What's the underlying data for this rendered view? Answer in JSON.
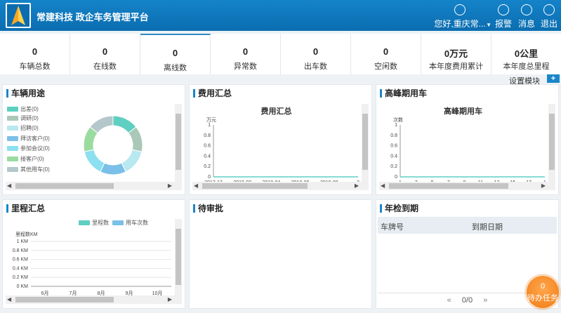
{
  "app": {
    "title": "常建科技 政企车务管理平台"
  },
  "header": {
    "user_label": "您好,重庆常...",
    "alarm_label": "报警",
    "message_label": "消息",
    "logout_label": "退出"
  },
  "stats": [
    {
      "value": "0",
      "label": "车辆总数"
    },
    {
      "value": "0",
      "label": "在线数"
    },
    {
      "value": "0",
      "label": "离线数"
    },
    {
      "value": "0",
      "label": "异常数"
    },
    {
      "value": "0",
      "label": "出车数"
    },
    {
      "value": "0",
      "label": "空闲数"
    },
    {
      "value": "0万元",
      "label": "本年度费用累计"
    },
    {
      "value": "0公里",
      "label": "本年度总里程"
    }
  ],
  "settings": {
    "label": "设置模块",
    "add_label": "+"
  },
  "panels": {
    "vehicle_use": {
      "title": "车辆用途",
      "legend": [
        {
          "label": "出差(0)",
          "color": "#5ecfc0"
        },
        {
          "label": "调研(0)",
          "color": "#aac8b8"
        },
        {
          "label": "招聘(0)",
          "color": "#b8e8f0"
        },
        {
          "label": "拜访客户(0)",
          "color": "#7ac0e8"
        },
        {
          "label": "参加会议(0)",
          "color": "#8ce0f0"
        },
        {
          "label": "接客户(0)",
          "color": "#9adca0"
        },
        {
          "label": "其他用车(0)",
          "color": "#b4c8cc"
        }
      ]
    },
    "cost": {
      "title": "费用汇总",
      "chart_title": "费用汇总",
      "unit": "万元"
    },
    "peak": {
      "title": "高峰期用车",
      "chart_title": "高峰期用车",
      "unit": "次数"
    },
    "mileage": {
      "title": "里程汇总",
      "legend_a": "里程数",
      "legend_b": "用车次数",
      "unit": "里程数KM"
    },
    "pending": {
      "title": "待审批"
    },
    "inspection": {
      "title": "年检到期",
      "col_plate": "车牌号",
      "col_date": "到期日期",
      "pager": "0/0",
      "prev": "«",
      "next": "»"
    }
  },
  "todo": {
    "count": "0",
    "label": "待办任务"
  },
  "colors": {
    "accent": "#1a86c8",
    "header": "#0b6db0",
    "todo": "#f07c12"
  },
  "chart_data": [
    {
      "type": "pie",
      "title": "",
      "categories": [
        "出差",
        "调研",
        "招聘",
        "拜访客户",
        "参加会议",
        "接客户",
        "其他用车"
      ],
      "values": [
        0,
        0,
        0,
        0,
        0,
        0,
        0
      ]
    },
    {
      "type": "line",
      "title": "费用汇总",
      "ylabel": "万元",
      "x": [
        "2017-12",
        "2018-02",
        "2018-04",
        "2018-06",
        "2018-08",
        "2"
      ],
      "yticks": [
        "0",
        "0.2",
        "0.4",
        "0.6",
        "0.8",
        "1"
      ],
      "ylim": [
        0,
        1
      ],
      "series": [
        {
          "values": [
            0,
            0,
            0,
            0,
            0,
            0
          ]
        }
      ]
    },
    {
      "type": "line",
      "title": "高峰期用车",
      "ylabel": "次数",
      "x": [
        "1",
        "3",
        "5",
        "7",
        "9",
        "11",
        "13",
        "15",
        "17",
        "1"
      ],
      "yticks": [
        "0",
        "0.2",
        "0.4",
        "0.6",
        "0.8",
        "1"
      ],
      "ylim": [
        0,
        1
      ],
      "series": [
        {
          "values": [
            0,
            0,
            0,
            0,
            0,
            0,
            0,
            0,
            0,
            0
          ]
        }
      ]
    },
    {
      "type": "bar",
      "title": "",
      "ylabel": "里程数KM",
      "categories": [
        "6月",
        "7月",
        "8月",
        "9月",
        "10月"
      ],
      "yticks": [
        "0 KM",
        "0.2 KM",
        "0.4 KM",
        "0.6 KM",
        "0.8 KM",
        "1 KM"
      ],
      "ylim": [
        0,
        1
      ],
      "series": [
        {
          "name": "里程数",
          "values": [
            0,
            0,
            0,
            0,
            0
          ]
        },
        {
          "name": "用车次数",
          "values": [
            0,
            0,
            0,
            0,
            0
          ]
        }
      ]
    }
  ]
}
